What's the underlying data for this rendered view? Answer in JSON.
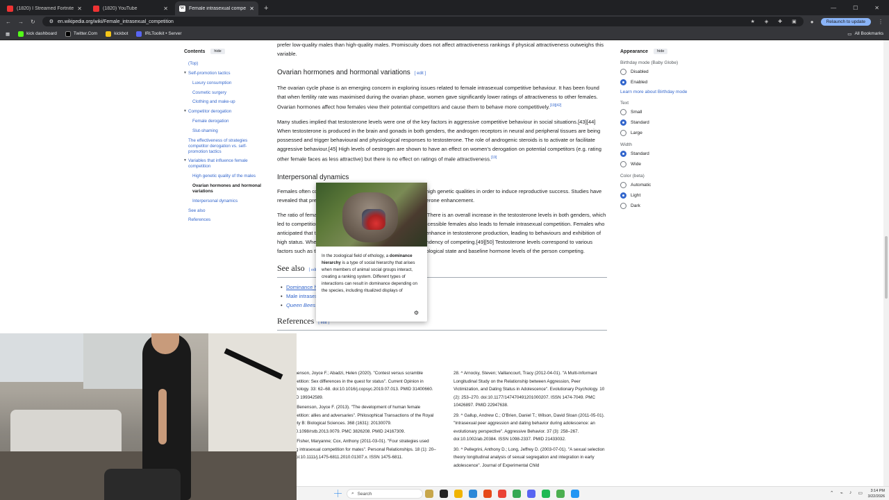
{
  "browser": {
    "tabs": [
      {
        "title": "(1820) I Streamed Fortnite for 1",
        "active": false
      },
      {
        "title": "(1820) YouTube",
        "active": false
      },
      {
        "title": "Female intrasexual competitio",
        "active": true
      }
    ],
    "new_tab": "+",
    "url": "en.wikipedia.org/wiki/Female_intrasexual_competition",
    "relaunch_label": "Relaunch to update",
    "bookmarks": [
      {
        "label": "kick dashboard",
        "color": "#53fc18"
      },
      {
        "label": "Twitter.Com",
        "color": "#000000"
      },
      {
        "label": "kickbot",
        "color": "#f5c518"
      },
      {
        "label": "IRLToolkit • Server",
        "color": "#5865f2"
      }
    ],
    "all_bookmarks": "All Bookmarks"
  },
  "toc": {
    "title": "Contents",
    "hide": "hide",
    "items": [
      {
        "label": "(Top)",
        "level": 0,
        "chev": false,
        "current": false
      },
      {
        "label": "Self-promotion tactics",
        "level": 0,
        "chev": true,
        "current": false
      },
      {
        "label": "Luxury consumption",
        "level": 1,
        "chev": false,
        "current": false
      },
      {
        "label": "Cosmetic surgery",
        "level": 1,
        "chev": false,
        "current": false
      },
      {
        "label": "Clothing and make-up",
        "level": 1,
        "chev": false,
        "current": false
      },
      {
        "label": "Competitor derogation",
        "level": 0,
        "chev": true,
        "current": false
      },
      {
        "label": "Female derogation",
        "level": 1,
        "chev": false,
        "current": false
      },
      {
        "label": "Slut-shaming",
        "level": 1,
        "chev": false,
        "current": false
      },
      {
        "label": "The effectiveness of strategies competitor derogation vs. self-promotion tactics",
        "level": 0,
        "chev": false,
        "current": false
      },
      {
        "label": "Variables that influence female competition",
        "level": 0,
        "chev": true,
        "current": false
      },
      {
        "label": "High genetic quality of the males",
        "level": 1,
        "chev": false,
        "current": false
      },
      {
        "label": "Ovarian hormones and hormonal variations",
        "level": 1,
        "chev": false,
        "current": true
      },
      {
        "label": "Interpersonal dynamics",
        "level": 1,
        "chev": false,
        "current": false
      },
      {
        "label": "See also",
        "level": 0,
        "chev": false,
        "current": false
      },
      {
        "label": "References",
        "level": 0,
        "chev": false,
        "current": false
      }
    ]
  },
  "article": {
    "top_para": "prefer low-quality males than high-quality males. Promiscuity does not affect attractiveness rankings if physical attractiveness outweighs this variable.",
    "top_sup1": "[40][35][39]",
    "top_sup2": "[41]",
    "h_ovarian": "Ovarian hormones and hormonal variations",
    "edit": "[ edit ]",
    "p1": "The ovarian cycle phase is an emerging concern in exploring issues related to female intrasexual competitive behaviour. It has been found that when fertility rate was maximised during the ovarian phase, women gave significantly lower ratings of attractiveness to other females. Ovarian hormones affect how females view their potential competitors and cause them to behave more competitively.",
    "p1_sup": "[19][42]",
    "p2": "Many studies implied that testosterone levels were one of the key factors in aggressive competitive behaviour in social situations.[43][44] When testosterone is produced in the brain and gonads in both genders, the androgen receptors in neural and peripheral tissues are being possessed and trigger behavioural and physiological responses to testosterone. The role of androgenic steroids is to activate or facilitate aggressive behaviour.[45] High levels of oestrogen are shown to have an effect on women's derogation on potential competitors (e.g. rating other female faces as less attractive) but there is no effect on ratings of male attractiveness.",
    "p2_sup": "[19]",
    "h_interp": "Interpersonal dynamics",
    "p3": "Females often compete for the attention of potential mates with high genetic qualities in order to induce reproductive success. Studies have revealed that presence of another sex individual leads to testosterone enhancement.",
    "p4": "The ratio of female to male has an effect on testosterone levels. There is an overall increase in the testosterone levels in both genders, which led to competition.[46] Females exposed to a large number of accessible females also leads to female intrasexual competition. Females who anticipated that to win in the female competition, it is thought to enhance in testosterone production, leading to behaviours and exhibition of high status. Whereas, losing in female competition lowers the tendency of competing.[49][50] Testosterone levels correspond to various factors such as the individual's emotional component,[51] psychological state and baseline hormone levels of the person competing.",
    "h_see": "See also",
    "see_items": [
      "Dominance hierarchy",
      "Male intrasexual competition",
      "Queen Bees and Wannabes"
    ],
    "h_refs": "References",
    "refs_left": [
      "^ Benenson, Joyce F.; Abadzi, Helen (2020). \"Contest versus scramble competition: Sex differences in the quest for status\". Current Opinion in Psychology. 33: 62–68. doi:10.1016/j.copsyc.2019.07.013. PMID 31400660. S2CID 199342589.",
      "^ a b Benenson, Joyce F. (2013). \"The development of human female competition: allies and adversaries\". Philosophical Transactions of the Royal Society B: Biological Sciences. 368 (1631): 20130079. doi:10.1098/rstb.2013.0079. PMC 3826208. PMID 24167309.",
      "^ a b Fisher, Maryanne; Cox, Anthony (2011-03-01). \"Four strategies used during intrasexual competition for mates\". Personal Relationships. 18 (1): 20–38. doi:10.1111/j.1475-6811.2010.01307.x. ISSN 1475-6811."
    ],
    "refs_right": [
      "28. ^ Arnocky, Steven; Vaillancourt, Tracy (2012-04-01). \"A Multi-Informant Longitudinal Study on the Relationship between Aggression, Peer Victimization, and Dating Status in Adolescence\". Evolutionary Psychology. 10 (2): 253–270. doi:10.1177/147470491201000207. ISSN 1474-7049. PMC 10426897. PMID 22947638.",
      "29. ^ Gallup, Andrew C.; O'Brien, Daniel T.; Wilson, David Sloan (2011-05-01). \"Intrasexual peer aggression and dating behavior during adolescence: an evolutionary perspective\". Aggressive Behavior. 37 (3): 258–267. doi:10.1002/ab.20384. ISSN 1098-2337. PMID 21433032.",
      "30. ^ Pellegrini, Anthony D.; Long, Jeffrey D. (2003-07-01). \"A sexual selection theory longitudinal analysis of sexual segregation and integration in early adolescence\". Journal of Experimental Child"
    ]
  },
  "popup": {
    "text_pre": "In the zoological field of ethology, a ",
    "text_bold": "dominance hierarchy",
    "text_post": " is a type of social hierarchy that arises when members of animal social groups interact, creating a ranking system. Different types of interactions can result in dominance depending on the species, including ritualized displays of"
  },
  "appearance": {
    "title": "Appearance",
    "hide": "hide",
    "birthday_label": "Birthday mode (Baby Globe)",
    "birthday_options": [
      {
        "label": "Disabled",
        "on": false
      },
      {
        "label": "Enabled",
        "on": true
      }
    ],
    "learn_more": "Learn more about Birthday mode",
    "text_label": "Text",
    "text_options": [
      {
        "label": "Small",
        "on": false
      },
      {
        "label": "Standard",
        "on": true
      },
      {
        "label": "Large",
        "on": false
      }
    ],
    "width_label": "Width",
    "width_options": [
      {
        "label": "Standard",
        "on": true
      },
      {
        "label": "Wide",
        "on": false
      }
    ],
    "color_label": "Color (beta)",
    "color_options": [
      {
        "label": "Automatic",
        "on": false
      },
      {
        "label": "Light",
        "on": true
      },
      {
        "label": "Dark",
        "on": false
      }
    ]
  },
  "taskbar": {
    "search": "Search",
    "time": "3:14 PM",
    "date": "3/22/2026",
    "apps": [
      "#c7a64a",
      "#222222",
      "#f0b400",
      "#2b88d8",
      "#e64a19",
      "#ea4335",
      "#34a853",
      "#5865f2",
      "#1db954",
      "#4caf50",
      "#2196f3"
    ]
  }
}
